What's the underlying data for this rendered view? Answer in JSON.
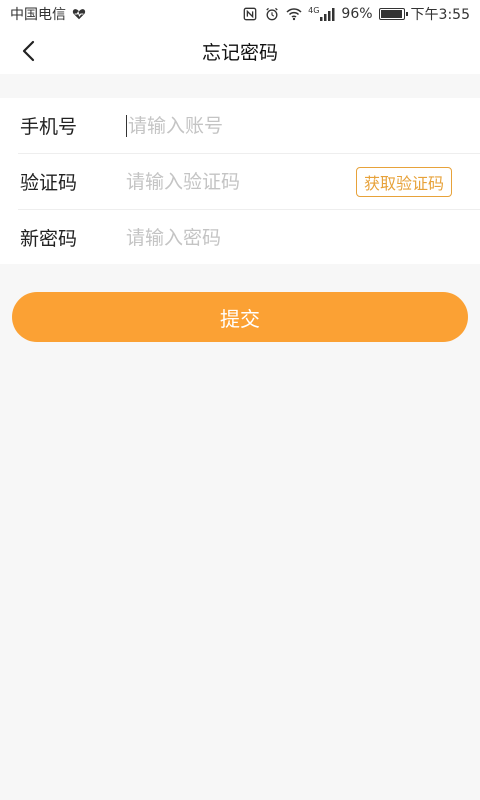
{
  "status_bar": {
    "carrier": "中国电信",
    "network": "4G",
    "battery": "96%",
    "battery_level": 0.96,
    "time": "下午3:55"
  },
  "nav": {
    "title": "忘记密码"
  },
  "form": {
    "phone_label": "手机号",
    "phone_placeholder": "请输入账号",
    "code_label": "验证码",
    "code_placeholder": "请输入验证码",
    "get_code_label": "获取验证码",
    "password_label": "新密码",
    "password_placeholder": "请输入密码"
  },
  "submit_label": "提交",
  "colors": {
    "accent": "#fba134",
    "code_button": "#e7a23a",
    "background": "#f7f7f7"
  }
}
